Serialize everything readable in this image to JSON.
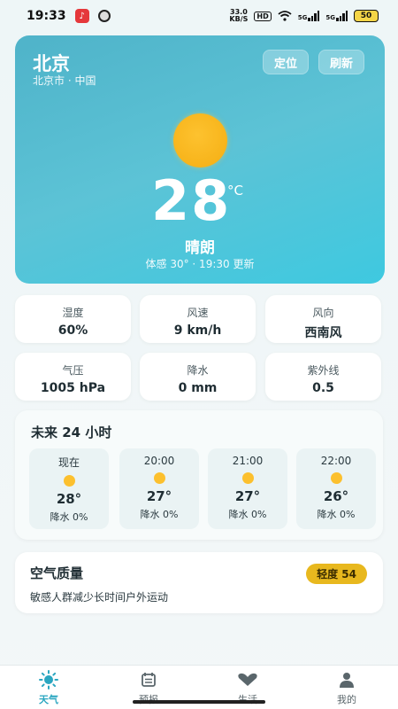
{
  "status_bar": {
    "time": "19:33",
    "net_speed_value": "33.0",
    "net_speed_unit": "KB/S",
    "hd": "HD",
    "sim1": "5G",
    "sim2": "5G",
    "battery": "50"
  },
  "hero": {
    "city": "北京",
    "region": "北京市 · 中国",
    "locate_label": "定位",
    "refresh_label": "刷新",
    "temperature": "28",
    "unit": "°C",
    "condition": "晴朗",
    "feels_like": "体感 30° · 19:30 更新",
    "weather_icon": "sun-icon"
  },
  "stats": [
    {
      "label": "湿度",
      "value": "60%"
    },
    {
      "label": "风速",
      "value": "9 km/h"
    },
    {
      "label": "风向",
      "value": "西南风"
    },
    {
      "label": "气压",
      "value": "1005 hPa"
    },
    {
      "label": "降水",
      "value": "0 mm"
    },
    {
      "label": "紫外线",
      "value": "0.5"
    }
  ],
  "forecast": {
    "title": "未来 24 小时",
    "hours": [
      {
        "time": "现在",
        "temp": "28°",
        "rain": "降水 0%",
        "icon": "sun-icon"
      },
      {
        "time": "20:00",
        "temp": "27°",
        "rain": "降水 0%",
        "icon": "sun-icon"
      },
      {
        "time": "21:00",
        "temp": "27°",
        "rain": "降水 0%",
        "icon": "sun-icon"
      },
      {
        "time": "22:00",
        "temp": "26°",
        "rain": "降水 0%",
        "icon": "sun-icon"
      }
    ]
  },
  "air_quality": {
    "title": "空气质量",
    "badge": "轻度 54",
    "description": "敏感人群减少长时间户外运动"
  },
  "nav": {
    "items": [
      {
        "label": "天气",
        "icon": "sun-icon"
      },
      {
        "label": "预报",
        "icon": "calendar-icon"
      },
      {
        "label": "生活",
        "icon": "heart-icon"
      },
      {
        "label": "我的",
        "icon": "person-icon"
      }
    ]
  },
  "colors": {
    "accent": "#2aa6c0",
    "hero_gradient_start": "#4fb3c9",
    "hero_gradient_end": "#3ec9e0",
    "sun": "#fcc02e",
    "aqi_badge": "#e8b81e"
  }
}
